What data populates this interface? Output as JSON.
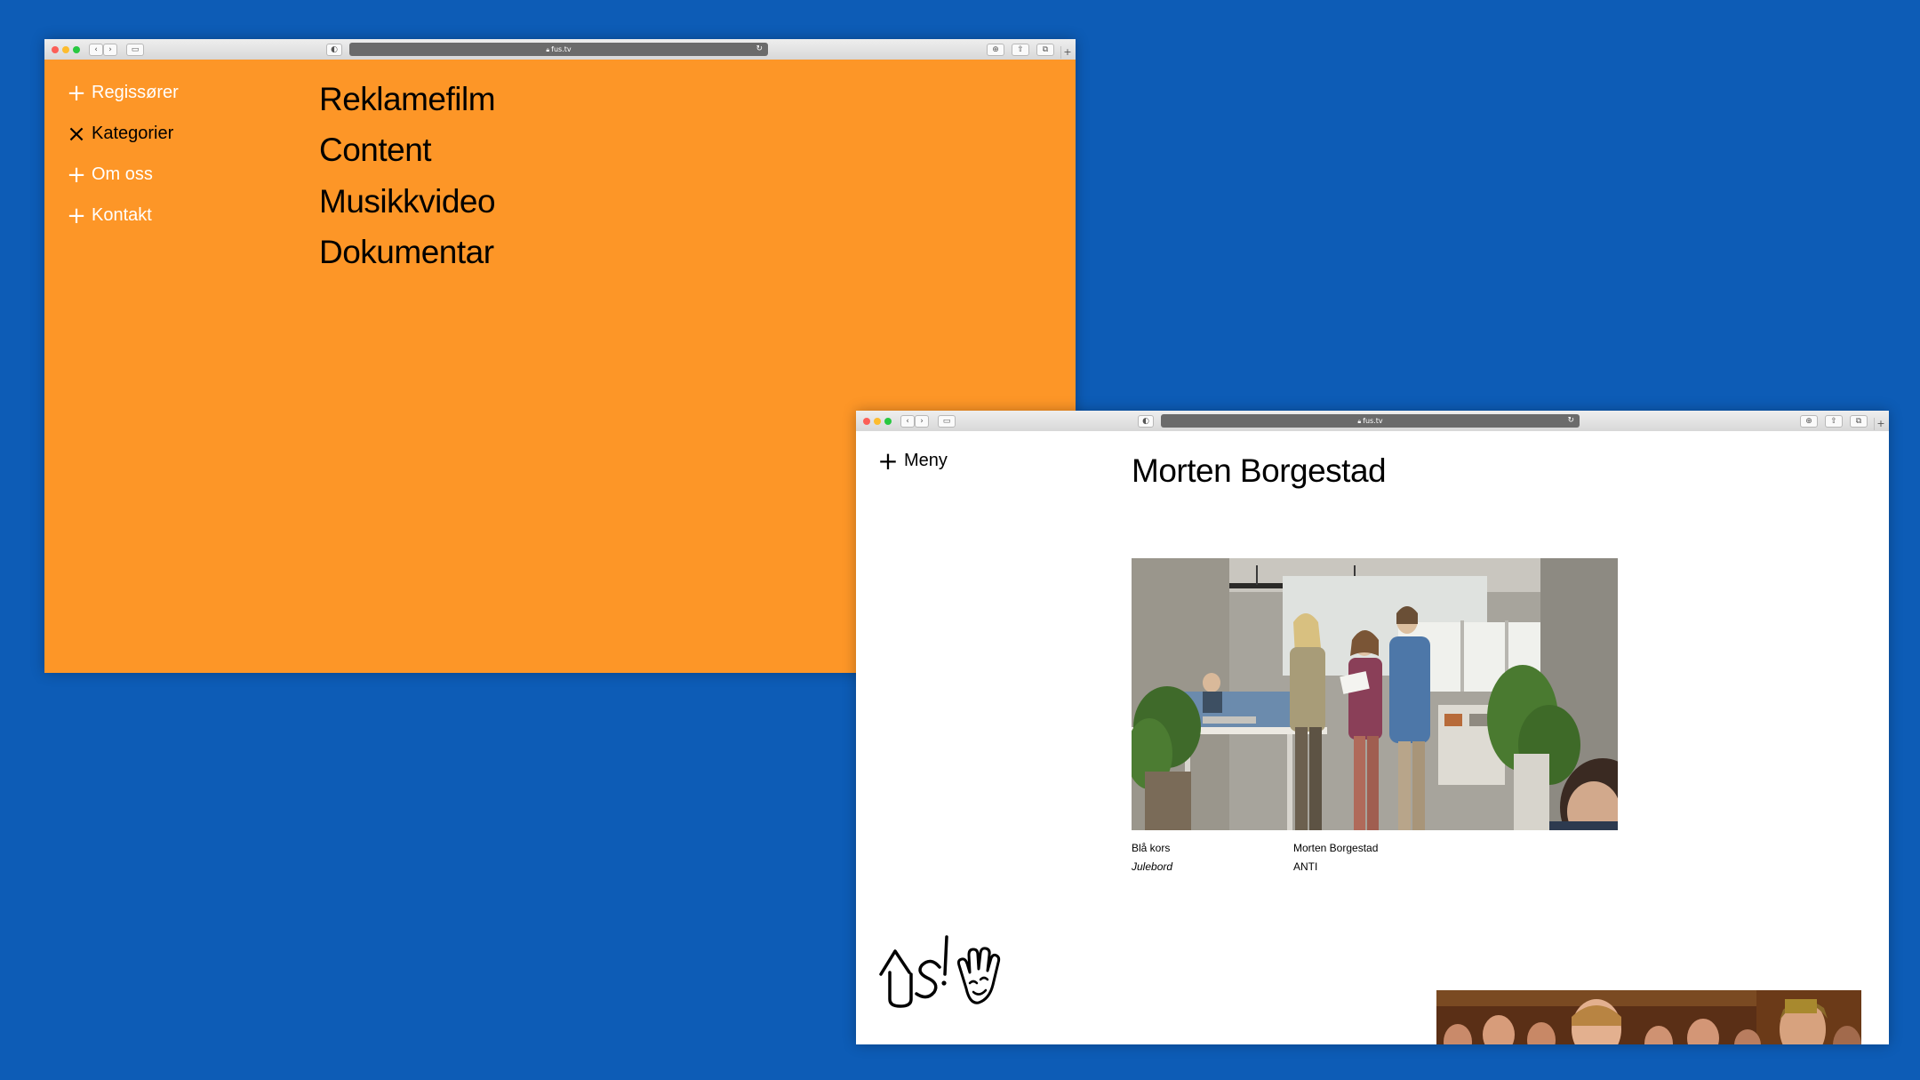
{
  "window_left": {
    "url": "fus.tv",
    "nav": {
      "items": [
        {
          "label": "Regissører",
          "icon": "plus-icon",
          "active": false
        },
        {
          "label": "Kategorier",
          "icon": "close-icon",
          "active": true
        },
        {
          "label": "Om oss",
          "icon": "plus-icon",
          "active": false
        },
        {
          "label": "Kontakt",
          "icon": "plus-icon",
          "active": false
        }
      ]
    },
    "categories": [
      "Reklamefilm",
      "Content",
      "Musikkvideo",
      "Dokumentar"
    ],
    "background_color": "#fd9627"
  },
  "window_right": {
    "url": "fus.tv",
    "menu_label": "Meny",
    "page_title": "Morten Borgestad",
    "project": {
      "client": "Blå kors",
      "title": "Julebord",
      "director": "Morten Borgestad",
      "agency": "ANTI"
    },
    "logo_text": "FUS!"
  },
  "desktop_color": "#0d5cb6"
}
